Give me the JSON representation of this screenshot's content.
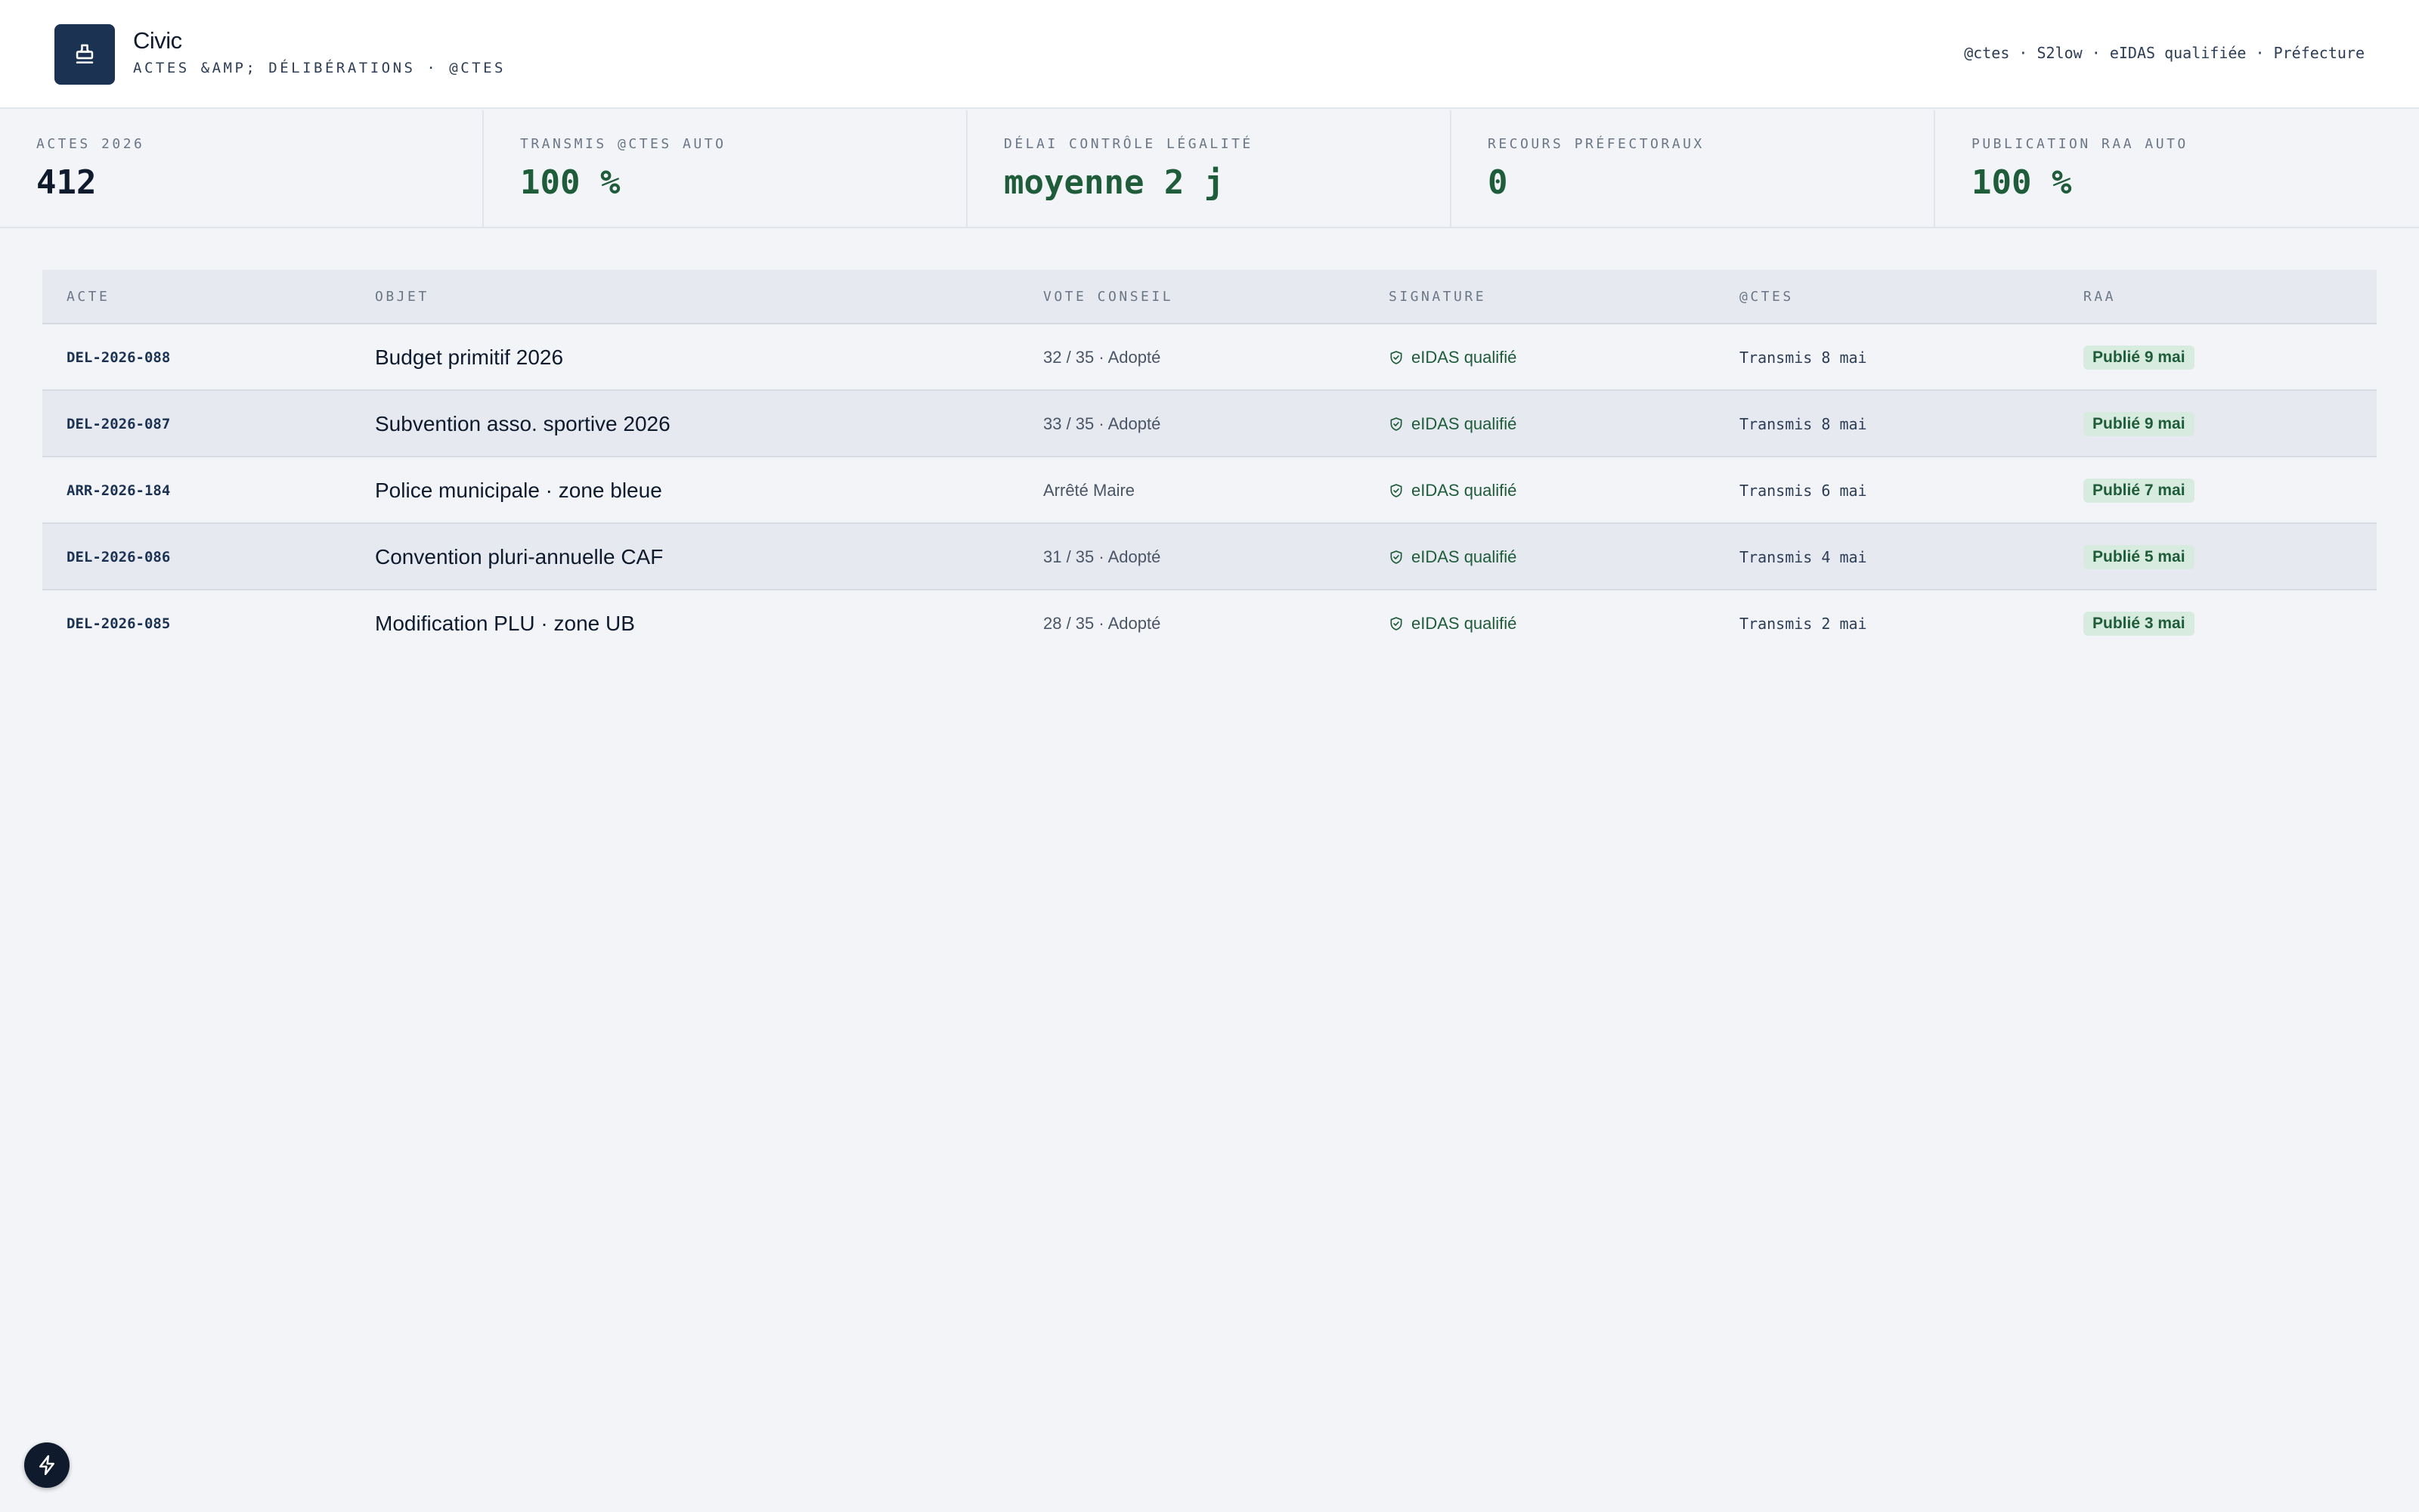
{
  "header": {
    "title": "Civic",
    "subtitle": "ACTES &AMP; DÉLIBÉRATIONS · @CTES",
    "meta": "@ctes · S2low · eIDAS qualifiée · Préfecture",
    "logo_icon": "stamp-icon"
  },
  "stats": [
    {
      "label": "ACTES 2026",
      "value": "412"
    },
    {
      "label": "TRANSMIS @CTES AUTO",
      "value": "100 %"
    },
    {
      "label": "DÉLAI CONTRÔLE LÉGALITÉ",
      "value": "moyenne 2 j"
    },
    {
      "label": "RECOURS PRÉFECTORAUX",
      "value": "0"
    },
    {
      "label": "PUBLICATION RAA AUTO",
      "value": "100 %"
    }
  ],
  "table": {
    "columns": [
      "ACTE",
      "OBJET",
      "VOTE CONSEIL",
      "SIGNATURE",
      "@CTES",
      "RAA"
    ],
    "rows": [
      {
        "acte": "DEL-2026-088",
        "objet": "Budget primitif 2026",
        "vote": "32 / 35 · Adopté",
        "signature": "eIDAS qualifié",
        "actes": "Transmis 8 mai",
        "raa": "Publié 9 mai"
      },
      {
        "acte": "DEL-2026-087",
        "objet": "Subvention asso. sportive 2026",
        "vote": "33 / 35 · Adopté",
        "signature": "eIDAS qualifié",
        "actes": "Transmis 8 mai",
        "raa": "Publié 9 mai"
      },
      {
        "acte": "ARR-2026-184",
        "objet": "Police municipale · zone bleue",
        "vote": "Arrêté Maire",
        "signature": "eIDAS qualifié",
        "actes": "Transmis 6 mai",
        "raa": "Publié 7 mai"
      },
      {
        "acte": "DEL-2026-086",
        "objet": "Convention pluri-annuelle CAF",
        "vote": "31 / 35 · Adopté",
        "signature": "eIDAS qualifié",
        "actes": "Transmis 4 mai",
        "raa": "Publié 5 mai"
      },
      {
        "acte": "DEL-2026-085",
        "objet": "Modification PLU · zone UB",
        "vote": "28 / 35 · Adopté",
        "signature": "eIDAS qualifié",
        "actes": "Transmis 2 mai",
        "raa": "Publié 3 mai"
      }
    ]
  },
  "colors": {
    "brand": "#1c3253",
    "success": "#1e5c3a",
    "badge_bg": "#d7ebdf",
    "background": "#f2f4f8"
  },
  "fab_icon": "lightning-icon"
}
